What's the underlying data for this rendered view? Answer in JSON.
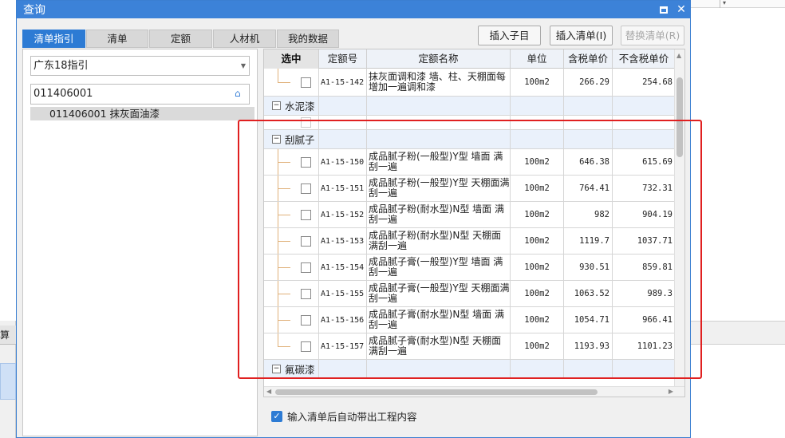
{
  "background": {
    "left_tab_text": "算"
  },
  "dialog": {
    "title": "查询",
    "controls": {
      "maximize_icon": "maximize-icon",
      "close_symbol": "✕"
    }
  },
  "tabs": [
    {
      "label": "清单指引",
      "active": true
    },
    {
      "label": "清单",
      "active": false
    },
    {
      "label": "定额",
      "active": false
    },
    {
      "label": "人材机",
      "active": false
    },
    {
      "label": "我的数据",
      "active": false
    }
  ],
  "left_panel": {
    "guide_select": "广东18指引",
    "code_input": "011406001",
    "tree_item": "011406001  抹灰面油漆"
  },
  "toolbar": {
    "insert_child": "插入子目",
    "insert_list": "插入清单(I)",
    "replace_list": "替换清单(R)"
  },
  "grid": {
    "headers": [
      "选中",
      "定额号",
      "定额名称",
      "单位",
      "含税单价",
      "不含税单价"
    ],
    "rows": [
      {
        "kind": "item",
        "code": "A1-15-142",
        "name": "抹灰面调和漆 墙、柱、天棚面每增加一遍调和漆",
        "unit": "100m2",
        "tax_price": "266.29",
        "notax_price": "254.68"
      },
      {
        "kind": "group",
        "label": "水泥漆"
      },
      {
        "kind": "empty"
      },
      {
        "kind": "group",
        "label": "刮腻子"
      },
      {
        "kind": "item",
        "code": "A1-15-150",
        "name": "成品腻子粉(一般型)Y型 墙面 满刮一遍",
        "unit": "100m2",
        "tax_price": "646.38",
        "notax_price": "615.69"
      },
      {
        "kind": "item",
        "code": "A1-15-151",
        "name": "成品腻子粉(一般型)Y型 天棚面满刮一遍",
        "unit": "100m2",
        "tax_price": "764.41",
        "notax_price": "732.31"
      },
      {
        "kind": "item",
        "code": "A1-15-152",
        "name": "成品腻子粉(耐水型)N型 墙面 满刮一遍",
        "unit": "100m2",
        "tax_price": "982",
        "notax_price": "904.19"
      },
      {
        "kind": "item",
        "code": "A1-15-153",
        "name": "成品腻子粉(耐水型)N型 天棚面满刮一遍",
        "unit": "100m2",
        "tax_price": "1119.7",
        "notax_price": "1037.71"
      },
      {
        "kind": "item",
        "code": "A1-15-154",
        "name": "成品腻子膏(一般型)Y型 墙面 满刮一遍",
        "unit": "100m2",
        "tax_price": "930.51",
        "notax_price": "859.81"
      },
      {
        "kind": "item",
        "code": "A1-15-155",
        "name": "成品腻子膏(一般型)Y型 天棚面满刮一遍",
        "unit": "100m2",
        "tax_price": "1063.52",
        "notax_price": "989.3"
      },
      {
        "kind": "item",
        "code": "A1-15-156",
        "name": "成品腻子膏(耐水型)N型 墙面 满刮一遍",
        "unit": "100m2",
        "tax_price": "1054.71",
        "notax_price": "966.41"
      },
      {
        "kind": "item",
        "code": "A1-15-157",
        "name": "成品腻子膏(耐水型)N型 天棚面满刮一遍",
        "unit": "100m2",
        "tax_price": "1193.93",
        "notax_price": "1101.23"
      },
      {
        "kind": "group",
        "label": "氟碳漆"
      }
    ]
  },
  "auto_bring": {
    "label": "输入清单后自动带出工程内容",
    "checked": true
  },
  "colors": {
    "accent": "#2d7bd4",
    "annotation": "#e02020"
  }
}
